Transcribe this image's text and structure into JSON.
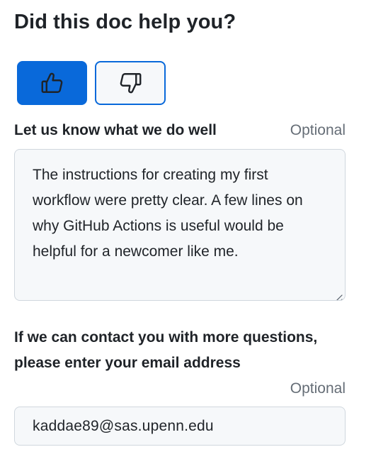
{
  "feedback": {
    "title": "Did this doc help you?",
    "vote": {
      "yes_icon": "thumbs-up-icon",
      "no_icon": "thumbs-down-icon",
      "selected": "yes",
      "accent_color": "#0969da"
    },
    "comment": {
      "label": "Let us know what we do well",
      "optional_text": "Optional",
      "value": "The instructions for creating my first workflow were pretty clear. A few lines on why GitHub Actions is useful would be helpful for a newcomer like me."
    },
    "email": {
      "label": "If we can contact you with more questions, please enter your email address",
      "optional_text": "Optional",
      "value": "kaddae89@sas.upenn.edu"
    }
  }
}
